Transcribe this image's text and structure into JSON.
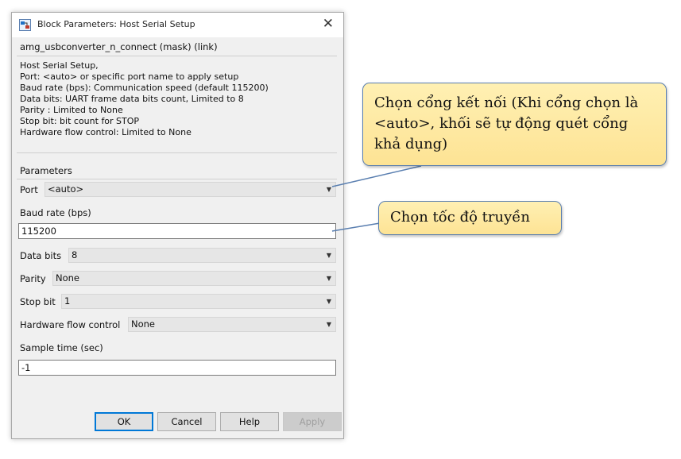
{
  "window": {
    "title": "Block Parameters: Host Serial Setup",
    "close_glyph": "✕"
  },
  "mask_title": "amg_usbconverter_n_connect (mask) (link)",
  "description": [
    "Host Serial Setup,",
    "Port: <auto> or specific port name to apply setup",
    "Baud rate (bps): Communication speed (default 115200)",
    "Data bits: UART frame data bits count, Limited to 8",
    "Parity : Limited to None",
    "Stop bit: bit count for STOP",
    "Hardware flow control: Limited to None"
  ],
  "parameters_heading": "Parameters",
  "fields": {
    "port": {
      "label": "Port",
      "value": "<auto>"
    },
    "baud_rate": {
      "label": "Baud rate (bps)",
      "value": "115200"
    },
    "data_bits": {
      "label": "Data bits",
      "value": "8"
    },
    "parity": {
      "label": "Parity",
      "value": "None"
    },
    "stop_bit": {
      "label": "Stop bit",
      "value": "1"
    },
    "hw_flow": {
      "label": "Hardware flow control",
      "value": "None"
    },
    "sample_time": {
      "label": "Sample time (sec)",
      "value": "-1"
    }
  },
  "buttons": {
    "ok": "OK",
    "cancel": "Cancel",
    "help": "Help",
    "apply": "Apply"
  },
  "callouts": {
    "port": "Chọn cổng kết nối (Khi cổng chọn là <auto>, khối sẽ tự động quét cổng khả dụng)",
    "baud": "Chọn tốc độ truyền"
  },
  "caret_glyph": "▼",
  "colors": {
    "callout_fill": "#fde394",
    "callout_border": "#5a7fb0",
    "dialog_bg": "#f0f0f0",
    "ok_border": "#0078d7"
  }
}
